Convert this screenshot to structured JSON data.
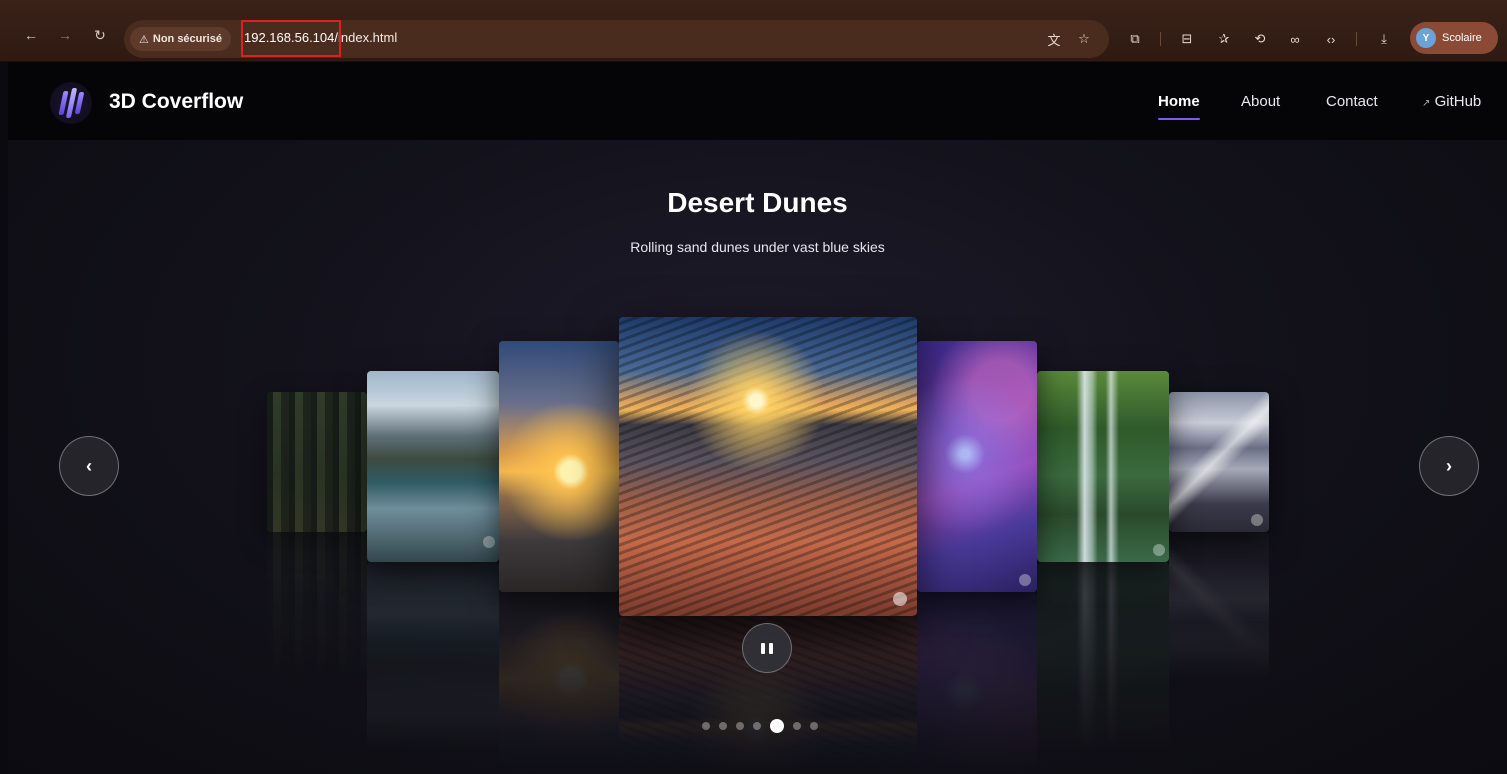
{
  "browser": {
    "security_label": "Non sécurisé",
    "url_host": "192.168.56.104/",
    "url_path": "index.html",
    "profile_initial": "Y",
    "profile_label": "Scolaire",
    "icons": {
      "back": "arrow-left-icon",
      "forward": "arrow-right-icon",
      "reload": "reload-icon",
      "warning": "warning-icon",
      "translate": "translate-icon",
      "bookmark": "star-icon",
      "extensions": "puzzle-icon",
      "sidebar": "sidebar-icon",
      "favorites": "favorites-icon",
      "history": "history-icon",
      "link": "link-icon",
      "devtools": "code-icon",
      "download": "download-icon"
    }
  },
  "header": {
    "site_title": "3D Coverflow",
    "nav": {
      "home": "Home",
      "about": "About",
      "contact": "Contact",
      "github": "GitHub",
      "github_arrow": "↗"
    }
  },
  "slide": {
    "title": "Desert Dunes",
    "subtitle": "Rolling sand dunes under vast blue skies"
  },
  "carousel": {
    "prev_label": "‹",
    "next_label": "›",
    "total_slides": 7,
    "active_index": 4,
    "cards": [
      {
        "name": "forest",
        "art": "art-forest"
      },
      {
        "name": "mountain-lake",
        "art": "art-lake"
      },
      {
        "name": "ocean-sunset",
        "art": "art-sunset"
      },
      {
        "name": "desert-dunes",
        "art": "art-dunes"
      },
      {
        "name": "galaxy",
        "art": "art-galaxy"
      },
      {
        "name": "waterfall",
        "art": "art-waterfall"
      },
      {
        "name": "snowy-mountain",
        "art": "art-mountain"
      }
    ]
  },
  "colors": {
    "accent": "#7c5cf0",
    "url_highlight": "#e01f1f",
    "browser_bar": "#3a2218"
  }
}
